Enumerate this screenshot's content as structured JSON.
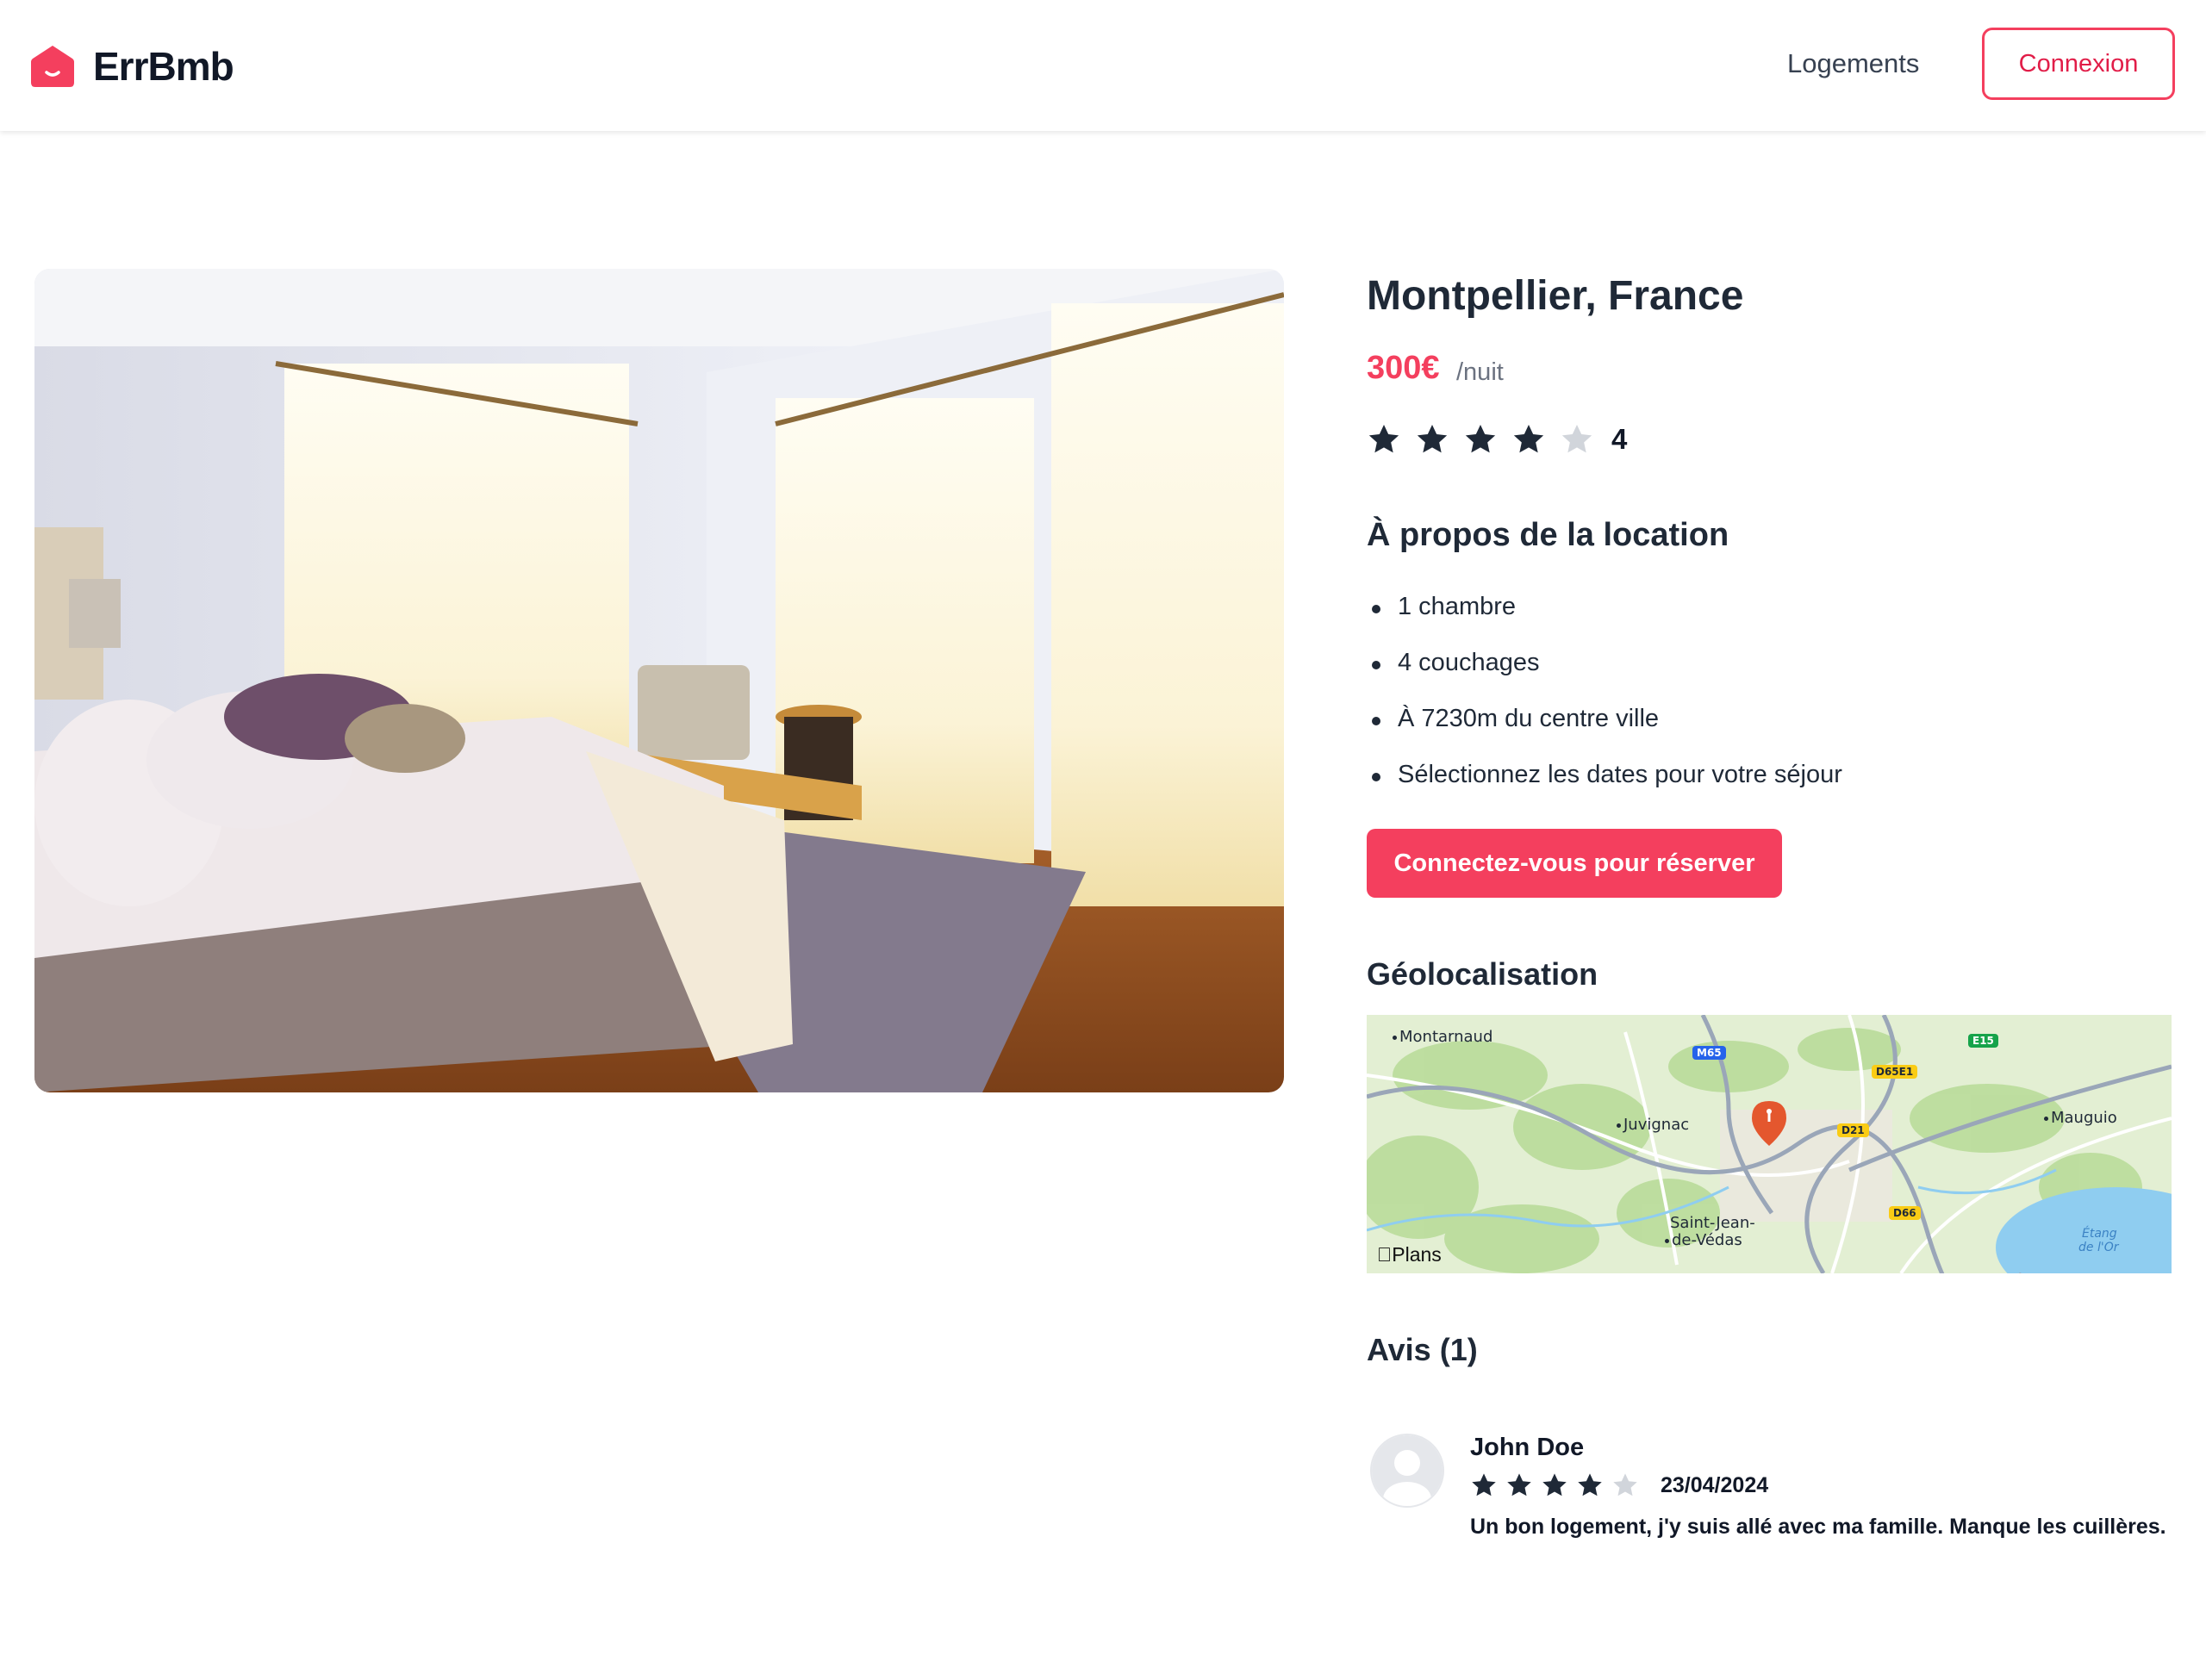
{
  "brand": {
    "name": "ErrBmb",
    "color": "#f43f5e"
  },
  "nav": {
    "link_label": "Logements",
    "login_label": "Connexion"
  },
  "listing": {
    "title": "Montpellier, France",
    "price": "300€",
    "price_unit": "/nuit",
    "rating": 4,
    "rating_max": 5,
    "rating_label": "4",
    "about_heading": "À propos de la location",
    "features": [
      "1 chambre",
      "4 couchages",
      "À 7230m du centre ville",
      "Sélectionnez les dates pour votre séjour"
    ],
    "book_label": "Connectez-vous pour réserver",
    "geo_heading": "Géolocalisation"
  },
  "map": {
    "attribution": "Plans",
    "places": [
      "Montarnaud",
      "Juvignac",
      "Mauguio",
      "Saint-Jean-",
      "de-Védas",
      "Étang",
      "de l'Or"
    ],
    "roads": [
      "M65",
      "D65E1",
      "E15",
      "D21",
      "D66"
    ]
  },
  "reviews": {
    "heading": "Avis (1)",
    "items": [
      {
        "author": "John Doe",
        "rating": 4,
        "date": "23/04/2024",
        "text": "Un bon logement, j'y suis allé avec ma famille. Manque les cuillères."
      }
    ]
  },
  "icons": {
    "logo": "house-smile-icon",
    "star_filled": "star-icon",
    "star_empty": "star-outline-icon",
    "map_pin": "map-pin-icon",
    "avatar": "user-avatar-icon"
  },
  "colors": {
    "accent": "#f43f5e",
    "star_filled": "#1f2937",
    "star_empty": "#d1d5db"
  }
}
